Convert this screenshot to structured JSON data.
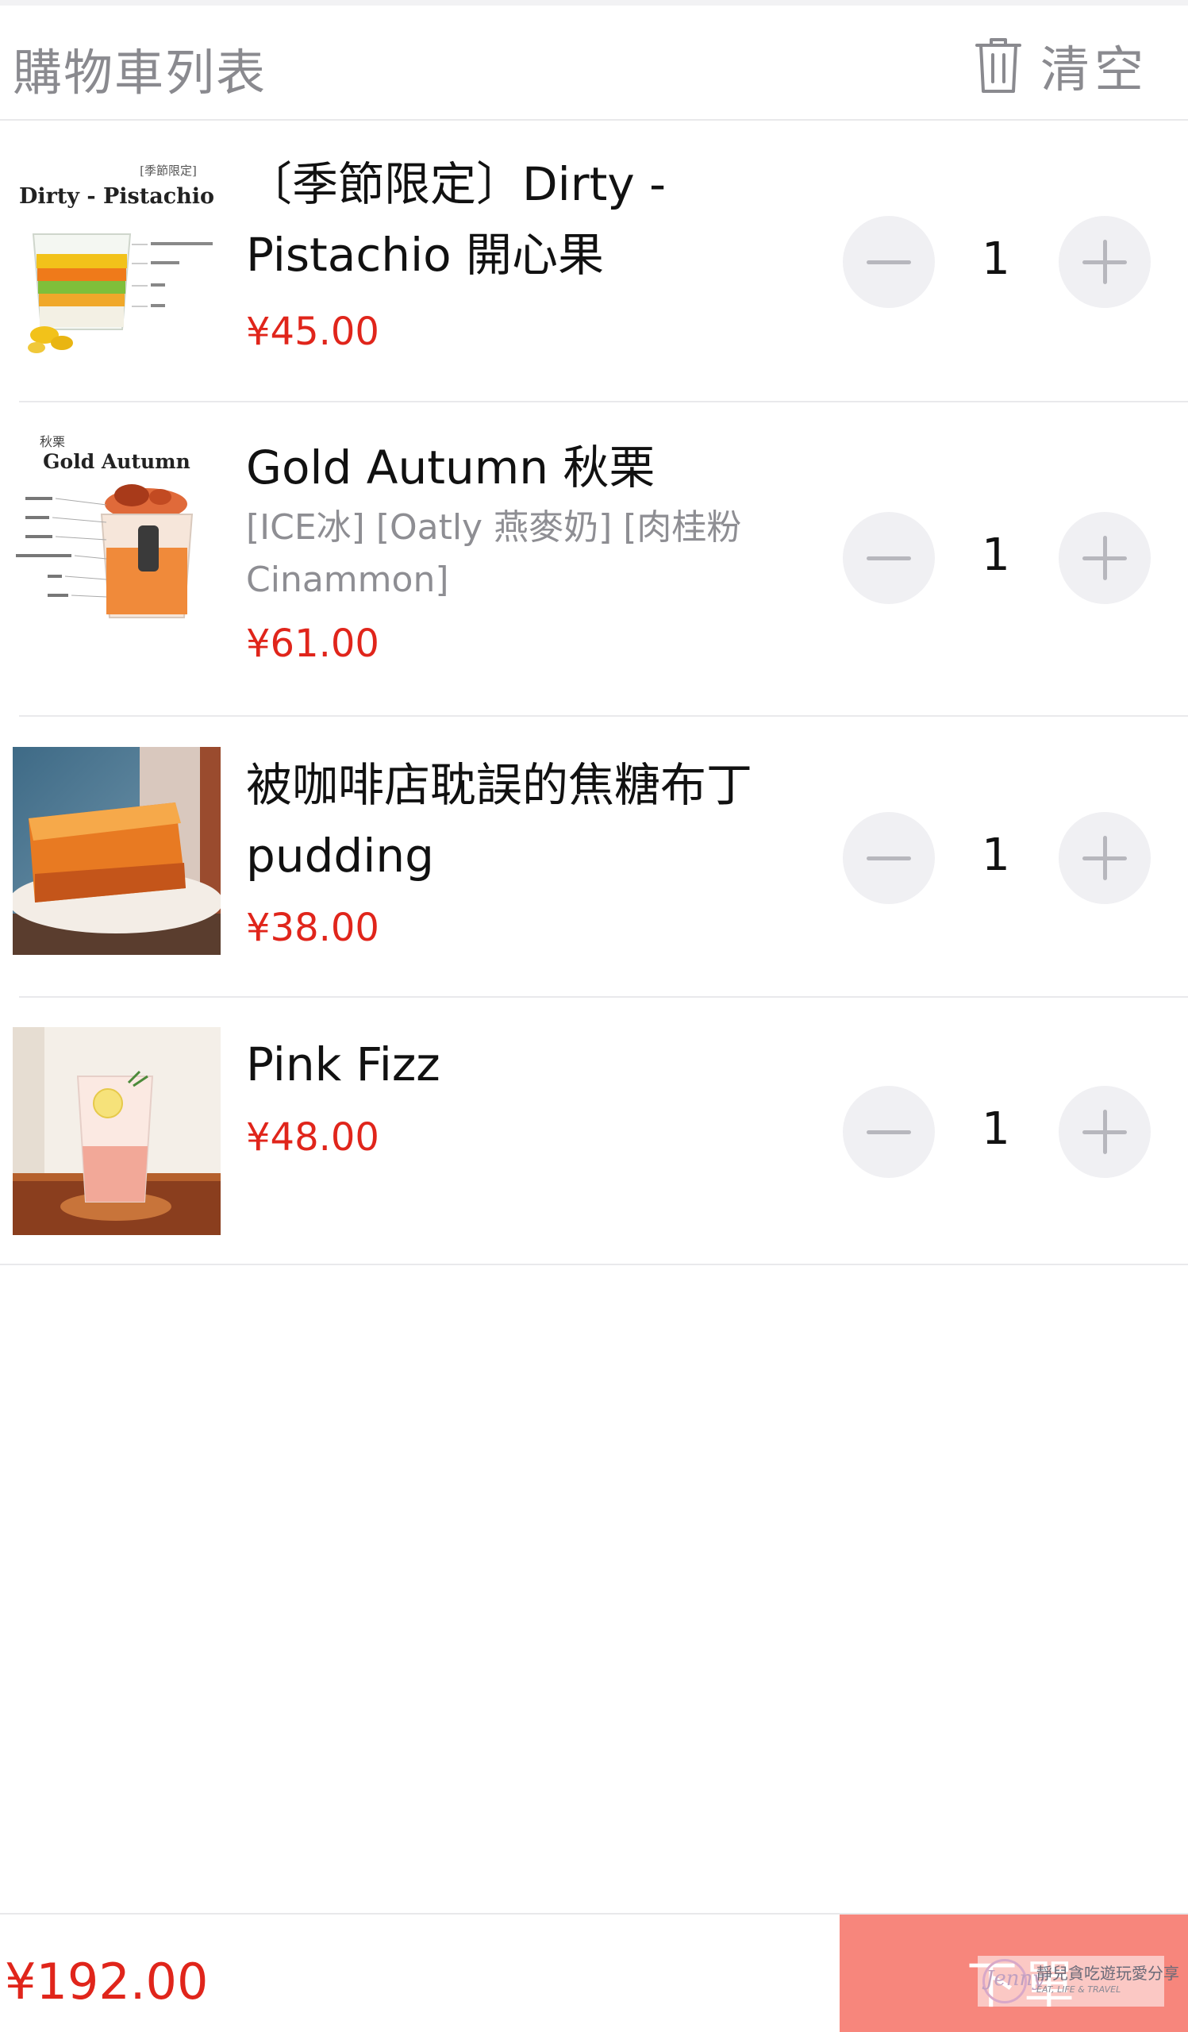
{
  "header": {
    "title": "購物車列表",
    "clear_label": "清空"
  },
  "items": [
    {
      "name": "〔季節限定〕Dirty - Pistachio 開心果",
      "price": "¥45.00",
      "qty": "1",
      "image_caption": "[季節限定]",
      "image_title": "Dirty - Pistachio"
    },
    {
      "name": "Gold Autumn 秋栗",
      "options": "[ICE冰] [Oatly 燕麥奶] [肉桂粉 Cinammon]",
      "price": "¥61.00",
      "qty": "1",
      "image_caption": "秋栗",
      "image_title": "Gold Autumn"
    },
    {
      "name": "被咖啡店耽誤的焦糖布丁 pudding",
      "price": "¥38.00",
      "qty": "1"
    },
    {
      "name": "Pink Fizz",
      "price": "¥48.00",
      "qty": "1"
    }
  ],
  "footer": {
    "total": "¥192.00",
    "order_label": "下單"
  },
  "watermark": {
    "script": "Jenny",
    "text": "靜兒貪吃遊玩愛分享",
    "sub": "EAT, LIFE & TRAVEL"
  },
  "colors": {
    "price": "#e0251b",
    "order_button": "#f7867c",
    "muted": "#8a8a8f"
  }
}
